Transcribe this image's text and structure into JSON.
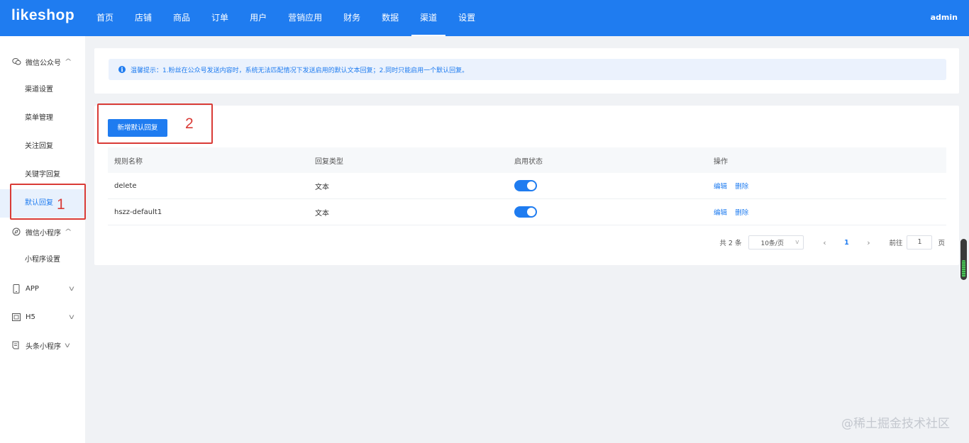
{
  "app": {
    "logo": "likeshop",
    "user": "admin"
  },
  "nav": [
    "首页",
    "店铺",
    "商品",
    "订单",
    "用户",
    "营销应用",
    "财务",
    "数据",
    "渠道",
    "设置"
  ],
  "nav_active_index": 8,
  "sidebar": {
    "wechat_official": {
      "label": "微信公众号",
      "icon": "wechat-icon"
    },
    "wechat_official_items": [
      "渠道设置",
      "菜单管理",
      "关注回复",
      "关键字回复",
      "默认回复"
    ],
    "mini_program": {
      "label": "微信小程序",
      "icon": "compass-icon"
    },
    "mini_program_items": [
      "小程序设置"
    ],
    "app": {
      "label": "APP",
      "icon": "phone-icon"
    },
    "h5": {
      "label": "H5",
      "icon": "h5-icon"
    },
    "toutiao": {
      "label": "头条小程序",
      "icon": "toutiao-icon"
    },
    "active_item": "默认回复"
  },
  "tip": {
    "text": "温馨提示：1.粉丝在公众号发送内容时，系统无法匹配情况下发送启用的默认文本回复；2.同时只能启用一个默认回复。"
  },
  "toolbar": {
    "add_label": "新增默认回复"
  },
  "table": {
    "headers": [
      "规则名称",
      "回复类型",
      "启用状态",
      "操作"
    ],
    "rows": [
      {
        "name": "delete",
        "type": "文本",
        "enabled": true
      },
      {
        "name": "hszz-default1",
        "type": "文本",
        "enabled": true
      }
    ],
    "edit_label": "编辑",
    "delete_label": "删除"
  },
  "pagination": {
    "total": "共 2 条",
    "page_size": "10条/页",
    "current": "1",
    "goto_label": "前往",
    "goto_value": "1",
    "page_label": "页"
  },
  "annotations": [
    "1",
    "2"
  ],
  "watermark": "@稀土掘金技术社区",
  "colors": {
    "primary": "#1f7cf0",
    "annotation": "#d93b36"
  }
}
